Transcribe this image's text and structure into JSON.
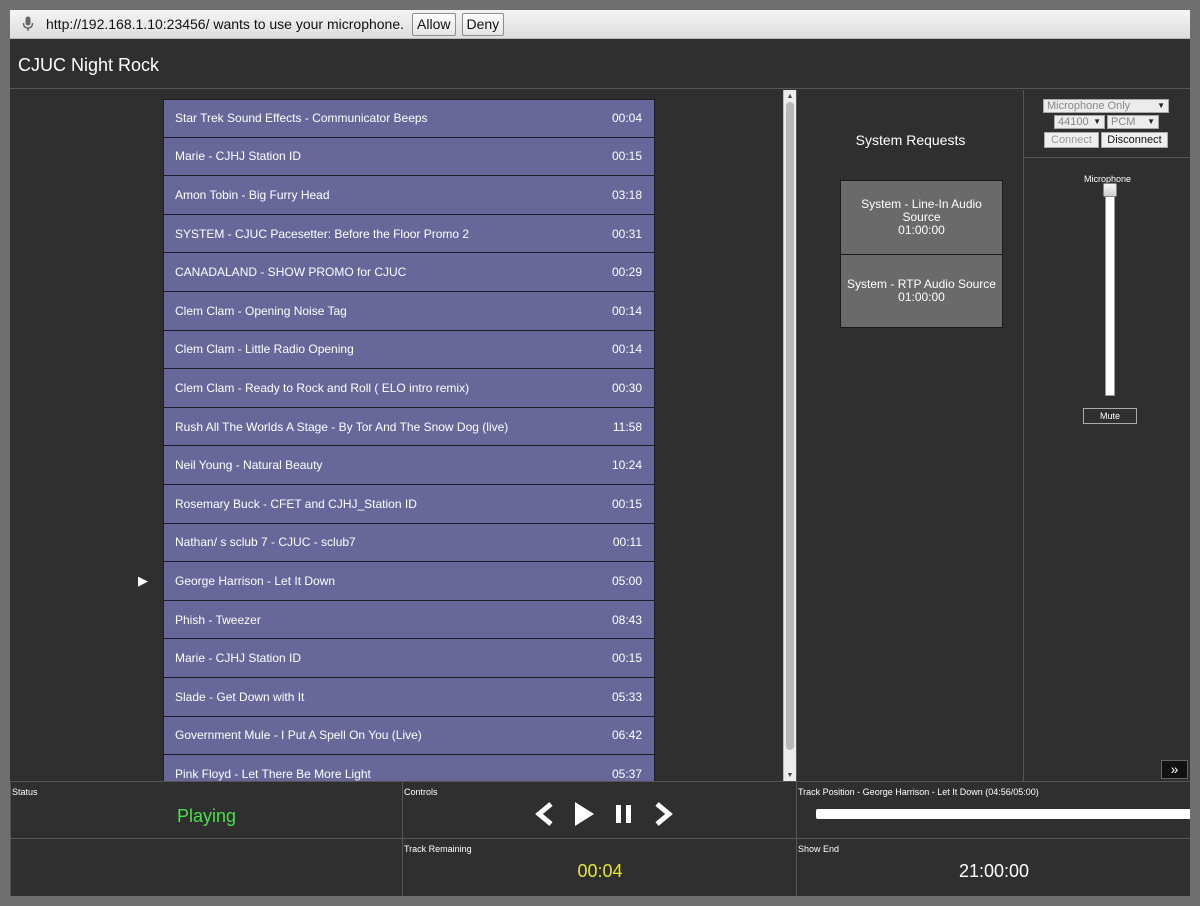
{
  "permission_bar": {
    "message": "http://192.168.1.10:23456/ wants to use your microphone.",
    "allow_label": "Allow",
    "deny_label": "Deny"
  },
  "app": {
    "title": "CJUC Night Rock"
  },
  "playlist": {
    "current_index": 12,
    "tracks": [
      {
        "title": "Star Trek Sound Effects - Communicator Beeps",
        "duration": "00:04"
      },
      {
        "title": "Marie - CJHJ Station ID",
        "duration": "00:15"
      },
      {
        "title": "Amon Tobin - Big Furry Head",
        "duration": "03:18"
      },
      {
        "title": "SYSTEM - CJUC Pacesetter: Before the Floor Promo 2",
        "duration": "00:31"
      },
      {
        "title": "CANADALAND - SHOW PROMO for CJUC",
        "duration": "00:29"
      },
      {
        "title": "Clem Clam - Opening Noise Tag",
        "duration": "00:14"
      },
      {
        "title": "Clem Clam - Little Radio Opening",
        "duration": "00:14"
      },
      {
        "title": "Clem Clam - Ready to Rock and Roll ( ELO intro remix)",
        "duration": "00:30"
      },
      {
        "title": "Rush All The Worlds A Stage - By Tor And The Snow Dog (live)",
        "duration": "11:58"
      },
      {
        "title": "Neil Young - Natural Beauty",
        "duration": "10:24"
      },
      {
        "title": "Rosemary Buck - CFET and CJHJ_Station ID",
        "duration": "00:15"
      },
      {
        "title": "Nathan/ s sclub 7 - CJUC - sclub7",
        "duration": "00:11"
      },
      {
        "title": "George Harrison - Let It Down",
        "duration": "05:00"
      },
      {
        "title": "Phish - Tweezer",
        "duration": "08:43"
      },
      {
        "title": "Marie - CJHJ Station ID",
        "duration": "00:15"
      },
      {
        "title": "Slade - Get Down with It",
        "duration": "05:33"
      },
      {
        "title": "Government Mule - I Put A Spell On You (Live)",
        "duration": "06:42"
      },
      {
        "title": "Pink Floyd - Let There Be More Light",
        "duration": "05:37"
      }
    ]
  },
  "system_requests": {
    "title": "System Requests",
    "items": [
      {
        "line1": "System - Line-In Audio",
        "line2": "Source",
        "time": "01:00:00"
      },
      {
        "line1": "System - RTP Audio Source",
        "time": "01:00:00"
      }
    ]
  },
  "mic_panel": {
    "source_select": "Microphone Only",
    "rate_select": "44100",
    "format_select": "PCM",
    "connect_label": "Connect",
    "disconnect_label": "Disconnect",
    "microphone_label": "Microphone",
    "mute_label": "Mute",
    "expand_label": "»",
    "mic_level": 1.0
  },
  "bottom": {
    "status_label": "Status",
    "status_value": "Playing",
    "controls_label": "Controls",
    "track_position_label": "Track Position - George Harrison - Let It Down (04:56/05:00)",
    "track_position_fraction": 0.987,
    "track_remaining_label": "Track Remaining",
    "track_remaining_value": "00:04",
    "show_end_label": "Show End",
    "show_end_value": "21:00:00"
  },
  "colors": {
    "track_bg": "#67679a",
    "status_green": "#4ae04a",
    "remaining_yellow": "#e6e63a"
  }
}
